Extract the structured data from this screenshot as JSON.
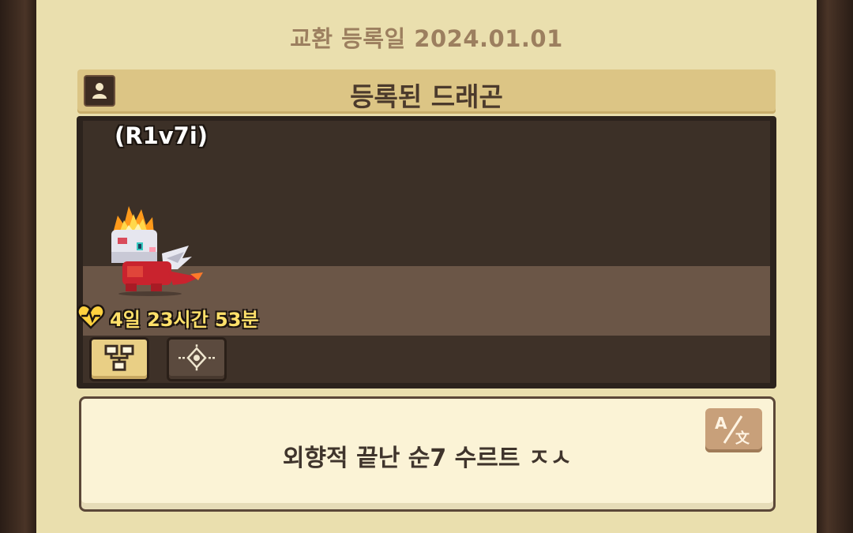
{
  "registration": {
    "date_label": "교환 등록일 2024.01.01"
  },
  "section": {
    "title": "등록된 드래곤",
    "icon": "person-icon"
  },
  "dragon": {
    "owner_name": "(R1v7i)",
    "timer_label": "4일 23시간 53분",
    "timer_icon": "heart-pulse-icon"
  },
  "tabs": [
    {
      "icon": "family-tree-icon",
      "selected": true
    },
    {
      "icon": "crosshair-icon",
      "selected": false
    }
  ],
  "message": {
    "text": "외향적 끝난 순7 수르트 ㅈㅅ",
    "translate_icon": "translate-icon"
  },
  "colors": {
    "panel_bg": "#eadfae",
    "header_bg": "#dcc585",
    "arena_bg": "#3c3027",
    "accent_yellow": "#ffe06a"
  }
}
